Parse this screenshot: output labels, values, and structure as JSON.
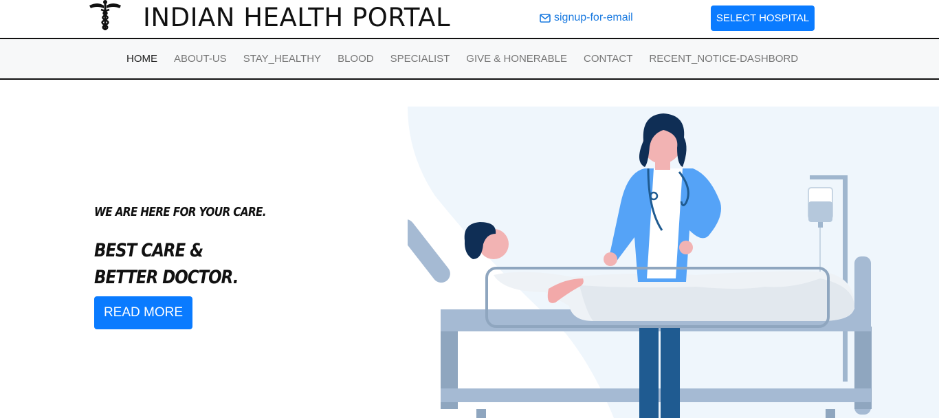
{
  "header": {
    "brand": "INDIAN HEALTH PORTAL",
    "signup_link": "signup-for-email",
    "select_hospital": "SELECT HOSPITAL"
  },
  "nav": {
    "items": [
      "HOME",
      "ABOUT-US",
      "STAY_HEALTHY",
      "BLOOD",
      "SPECIALIST",
      "GIVE & HONERABLE",
      "CONTACT",
      "RECENT_NOTICE-DASHBORD"
    ],
    "active": "HOME"
  },
  "hero": {
    "tagline": "WE ARE HERE FOR YOUR CARE.",
    "title_line1": "BEST CARE &",
    "title_line2": "BETTER DOCTOR.",
    "read_more": "READ MORE"
  },
  "colors": {
    "accent": "#0a7bff",
    "link": "#1a7ae0",
    "nav_bg": "#f7f8f9",
    "doctor_coat": "#55a3f7"
  }
}
